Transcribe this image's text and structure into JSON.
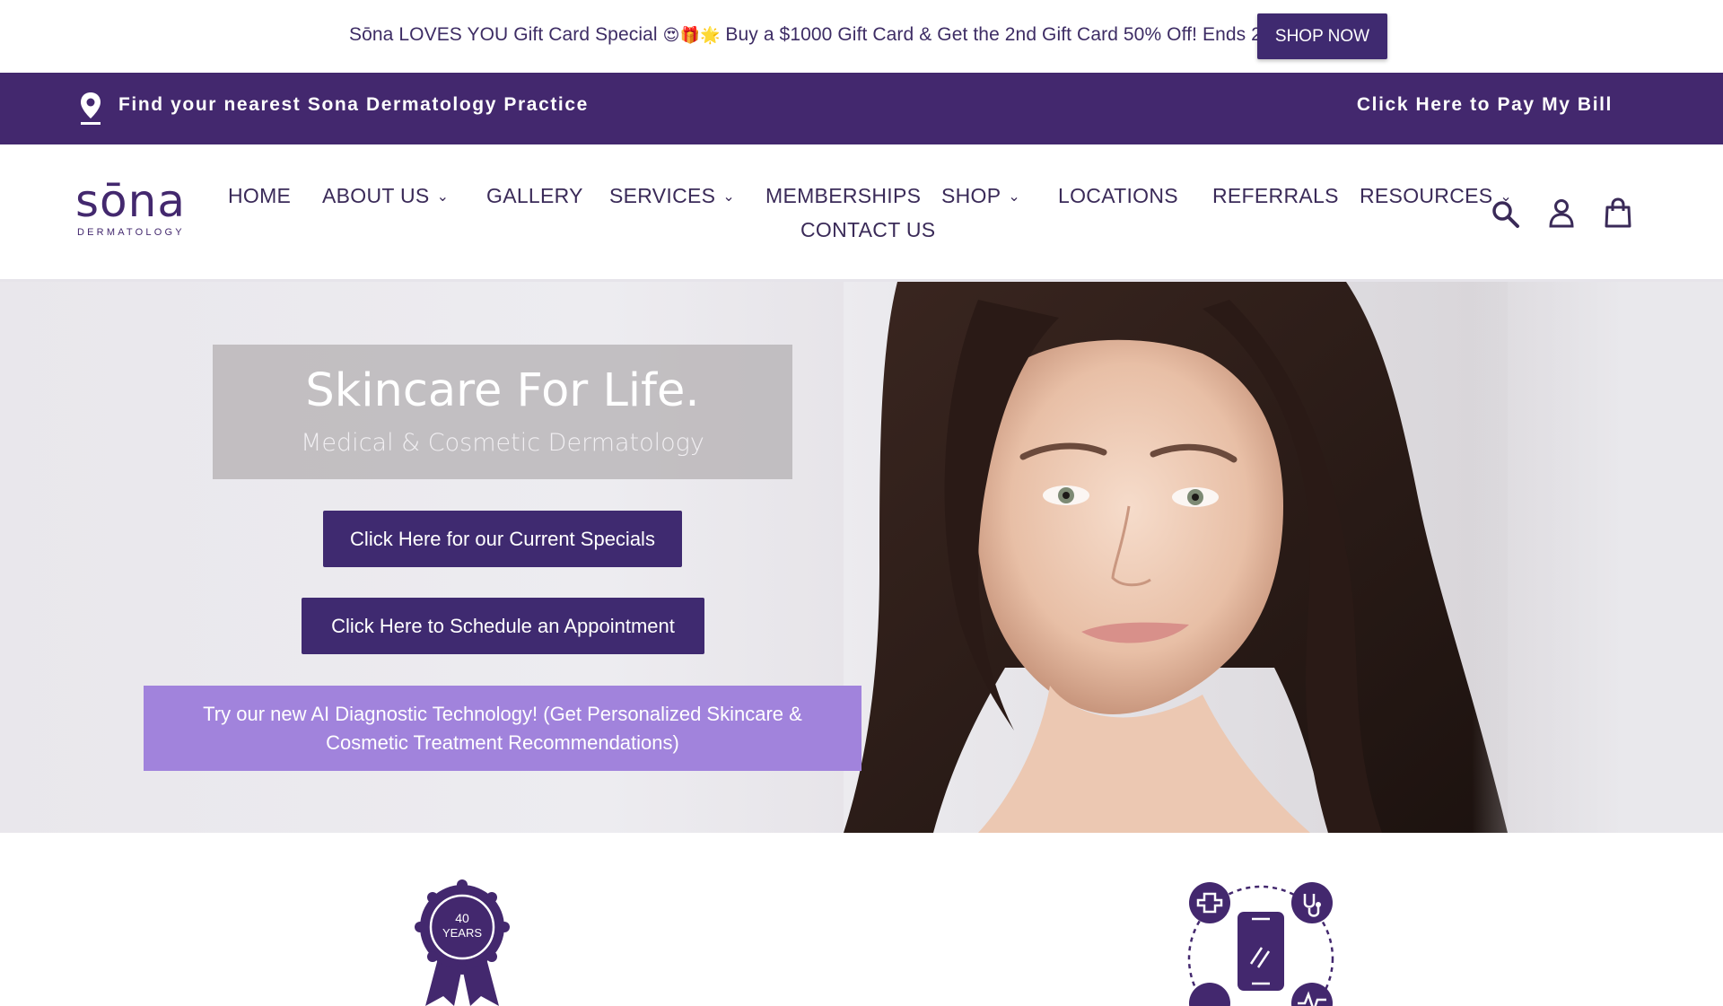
{
  "announcement": {
    "text_before": "Sōna LOVES YOU Gift Card Special",
    "emojis": "😍🎁🌟",
    "text_after": "Buy a $1000 Gift Card & Get the 2nd Gift Card 50% Off! Ends 2/21",
    "button_label": "SHOP NOW"
  },
  "utility_bar": {
    "find_label": "Find your nearest Sona Dermatology Practice",
    "pay_label": "Click Here to Pay My Bill",
    "background": "#43286e"
  },
  "logo": {
    "word": "sōna",
    "subtitle": "DERMATOLOGY"
  },
  "nav": {
    "items": [
      {
        "label": "HOME",
        "has_dropdown": false
      },
      {
        "label": "ABOUT US",
        "has_dropdown": true
      },
      {
        "label": "GALLERY",
        "has_dropdown": false
      },
      {
        "label": "SERVICES",
        "has_dropdown": true
      },
      {
        "label": "MEMBERSHIPS",
        "has_dropdown": false
      },
      {
        "label": "SHOP",
        "has_dropdown": true
      },
      {
        "label": "LOCATIONS",
        "has_dropdown": false
      },
      {
        "label": "REFERRALS",
        "has_dropdown": false
      },
      {
        "label": "RESOURCES",
        "has_dropdown": true
      },
      {
        "label": "CONTACT US",
        "has_dropdown": false
      }
    ],
    "icons": [
      "search-icon",
      "account-icon",
      "cart-icon"
    ]
  },
  "hero": {
    "headline": "Skincare For Life.",
    "subheadline": "Medical & Cosmetic Dermatology",
    "cta_specials": "Click Here for our Current Specials",
    "cta_schedule": "Click Here to Schedule an Appointment",
    "cta_ai": "Try our new AI Diagnostic Technology! (Get Personalized Skincare & Cosmetic Treatment Recommendations)"
  },
  "features": {
    "badge_text_line1": "40",
    "badge_text_line2": "YEARS"
  },
  "colors": {
    "brand_purple": "#43286e",
    "button_purple": "#3f2a70",
    "ai_button_lavender": "#a183dc"
  }
}
